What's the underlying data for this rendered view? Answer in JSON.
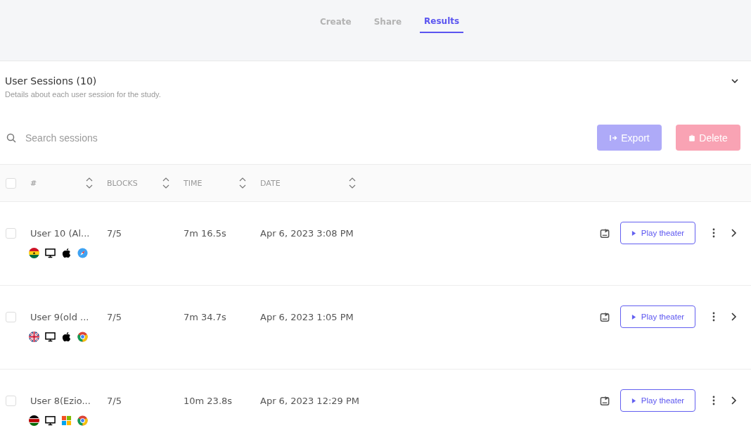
{
  "tabs": [
    {
      "label": "Create",
      "selected": false
    },
    {
      "label": "Share",
      "selected": false
    },
    {
      "label": "Results",
      "selected": true
    }
  ],
  "section": {
    "title": "User Sessions (10)",
    "subtitle": "Details about each user session for the study.",
    "expanded": true
  },
  "search": {
    "placeholder": "Search sessions"
  },
  "actions": [
    {
      "label": "Export",
      "kind": "export",
      "disabled": true
    },
    {
      "label": "Delete",
      "kind": "delete",
      "disabled": true
    }
  ],
  "table": {
    "all_checked": false,
    "columns": [
      "#",
      "BLOCKS",
      "TIME",
      "DATE"
    ],
    "rows": [
      {
        "checked": false,
        "name": "User 10 (Al...",
        "blocks": "7/5",
        "time": "7m 16.5s",
        "date": "Apr 6, 2023 3:08 PM",
        "action": "Play theater"
      },
      {
        "checked": false,
        "name": "User 9(old ...",
        "blocks": "7/5",
        "time": "7m 34.7s",
        "date": "Apr 6, 2023 1:05 PM",
        "action": "Play theater"
      },
      {
        "checked": false,
        "name": "User 8(Ezio...",
        "blocks": "7/5",
        "time": "10m 23.8s",
        "date": "Apr 6, 2023 12:29 PM",
        "action": "Play theater"
      }
    ]
  }
}
